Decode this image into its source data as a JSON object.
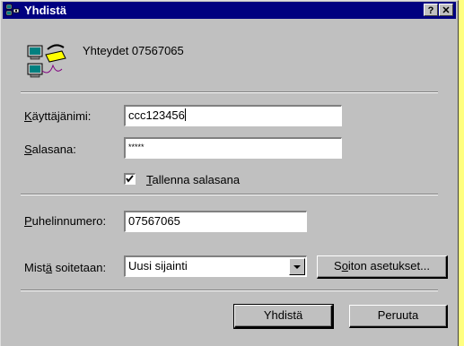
{
  "window": {
    "title": "Yhdistä",
    "help_label": "?",
    "close_label": "✕"
  },
  "header": {
    "connection_name": "Yhteydet 07567065"
  },
  "form": {
    "username_label_u": "K",
    "username_label_rest": "äyttäjänimi:",
    "username_value": "ccc123456",
    "password_label_u": "S",
    "password_label_rest": "alasana:",
    "password_value": "*****",
    "save_password_u": "T",
    "save_password_rest": "allenna salasana",
    "save_password_checked": true,
    "phone_label_u": "P",
    "phone_label_rest": "uhelinnumero:",
    "phone_value": "07567065",
    "dialing_from_label_pre": "Mist",
    "dialing_from_label_u": "ä",
    "dialing_from_label_rest": " soitetaan:",
    "dialing_from_value": "Uusi sijainti",
    "dial_properties_pre": "S",
    "dial_properties_u": "o",
    "dial_properties_rest": "iton asetukset..."
  },
  "buttons": {
    "connect": "Yhdistä",
    "cancel": "Peruuta"
  }
}
